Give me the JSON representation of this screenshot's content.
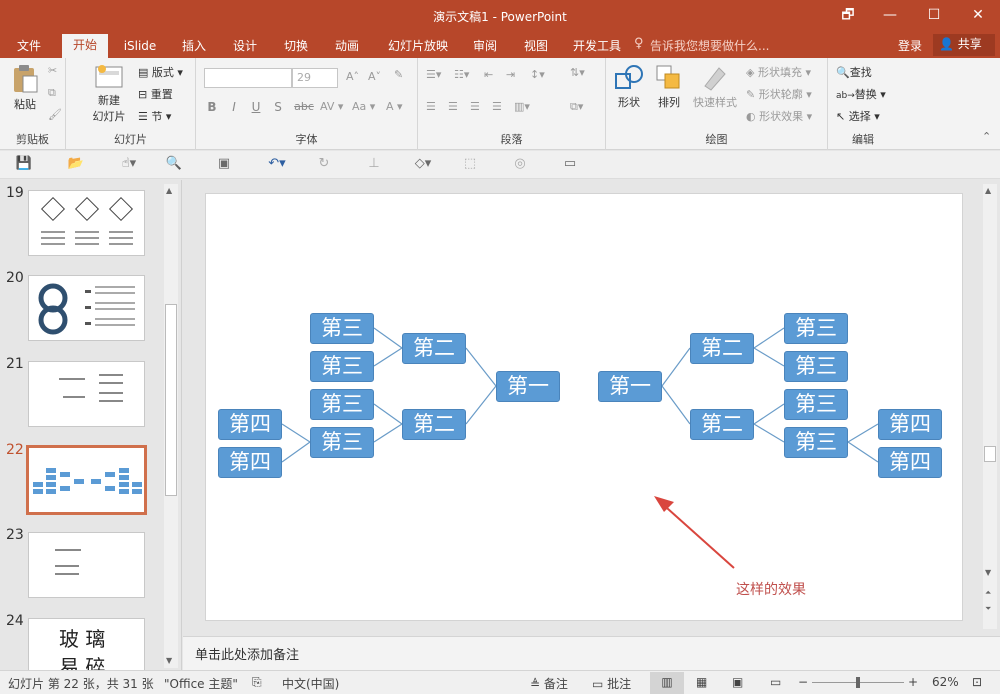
{
  "window": {
    "title": "演示文稿1 - PowerPoint",
    "buttons": {
      "restore": "🗗",
      "minimize": "—",
      "maximize": "☐",
      "close": "✕"
    }
  },
  "tabs": [
    {
      "label": "文件"
    },
    {
      "label": "开始"
    },
    {
      "label": "iSlide"
    },
    {
      "label": "插入"
    },
    {
      "label": "设计"
    },
    {
      "label": "切换"
    },
    {
      "label": "动画"
    },
    {
      "label": "幻灯片放映"
    },
    {
      "label": "审阅"
    },
    {
      "label": "视图"
    },
    {
      "label": "开发工具"
    }
  ],
  "tell_me": "告诉我您想要做什么...",
  "login": "登录",
  "share": "共享",
  "ribbon": {
    "clipboard": {
      "paste": "粘贴",
      "label": "剪贴板"
    },
    "slides": {
      "new_slide_line1": "新建",
      "new_slide_line2": "幻灯片",
      "layout": "版式",
      "reset": "重置",
      "section": "节",
      "label": "幻灯片"
    },
    "font": {
      "size": "29",
      "bold": "B",
      "italic": "I",
      "underline": "U",
      "strike": "S",
      "abc": "abc",
      "label": "字体"
    },
    "paragraph": {
      "label": "段落"
    },
    "drawing": {
      "shapes": "形状",
      "arrange": "排列",
      "quick_styles": "快速样式",
      "fill": "形状填充",
      "outline": "形状轮廓",
      "effects": "形状效果",
      "label": "绘图"
    },
    "editing": {
      "find": "查找",
      "replace": "替换",
      "select": "选择",
      "label": "编辑"
    }
  },
  "slides": [
    {
      "num": "19"
    },
    {
      "num": "20"
    },
    {
      "num": "21"
    },
    {
      "num": "22"
    },
    {
      "num": "23"
    },
    {
      "num": "24"
    }
  ],
  "thumb24_text": {
    "line1": "玻 璃",
    "line2": "易 碎"
  },
  "diagram": {
    "level1": "第一",
    "level2": "第二",
    "level3": "第三",
    "level4": "第四"
  },
  "annotation": "这样的效果",
  "notes_placeholder": "单击此处添加备注",
  "status": {
    "slide_info": "幻灯片 第 22 张，共 31 张",
    "theme": "\"Office 主题\"",
    "language": "中文(中国)",
    "notes": "备注",
    "comments": "批注",
    "zoom": "62%"
  },
  "colors": {
    "accent": "#b7472a",
    "node": "#5b9bd5",
    "annotation": "#c0504d"
  }
}
